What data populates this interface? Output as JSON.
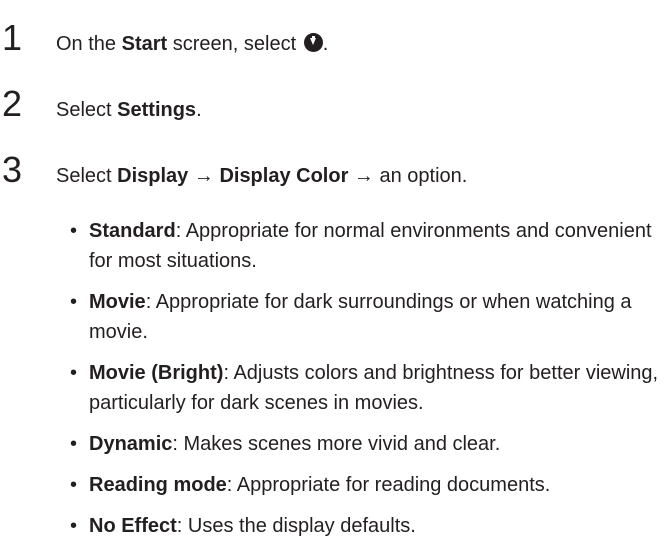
{
  "steps": [
    {
      "number": "1",
      "prefix": "On the ",
      "bold": "Start",
      "suffix": " screen, select ",
      "icon": "circle-down-arrow-icon",
      "end": "."
    },
    {
      "number": "2",
      "prefix": "Select ",
      "bold": "Settings",
      "suffix": "."
    },
    {
      "number": "3",
      "prefix": "Select ",
      "bold1": "Display",
      "arrow1": " → ",
      "bold2": "Display Color",
      "suffix": " → an option."
    }
  ],
  "options": [
    {
      "bullet": "•",
      "name": "Standard",
      "description": ": Appropriate for normal environments and convenient for most situations."
    },
    {
      "bullet": "•",
      "name": "Movie",
      "description": ": Appropriate for dark surroundings or when watching a movie."
    },
    {
      "bullet": "•",
      "name": "Movie (Bright)",
      "description": ": Adjusts colors and brightness for better viewing, particularly for dark scenes in movies."
    },
    {
      "bullet": "•",
      "name": "Dynamic",
      "description": ": Makes scenes more vivid and clear."
    },
    {
      "bullet": "•",
      "name": "Reading mode",
      "description": ": Appropriate for reading documents."
    },
    {
      "bullet": "•",
      "name": "No Effect",
      "description": ": Uses the display defaults."
    }
  ]
}
